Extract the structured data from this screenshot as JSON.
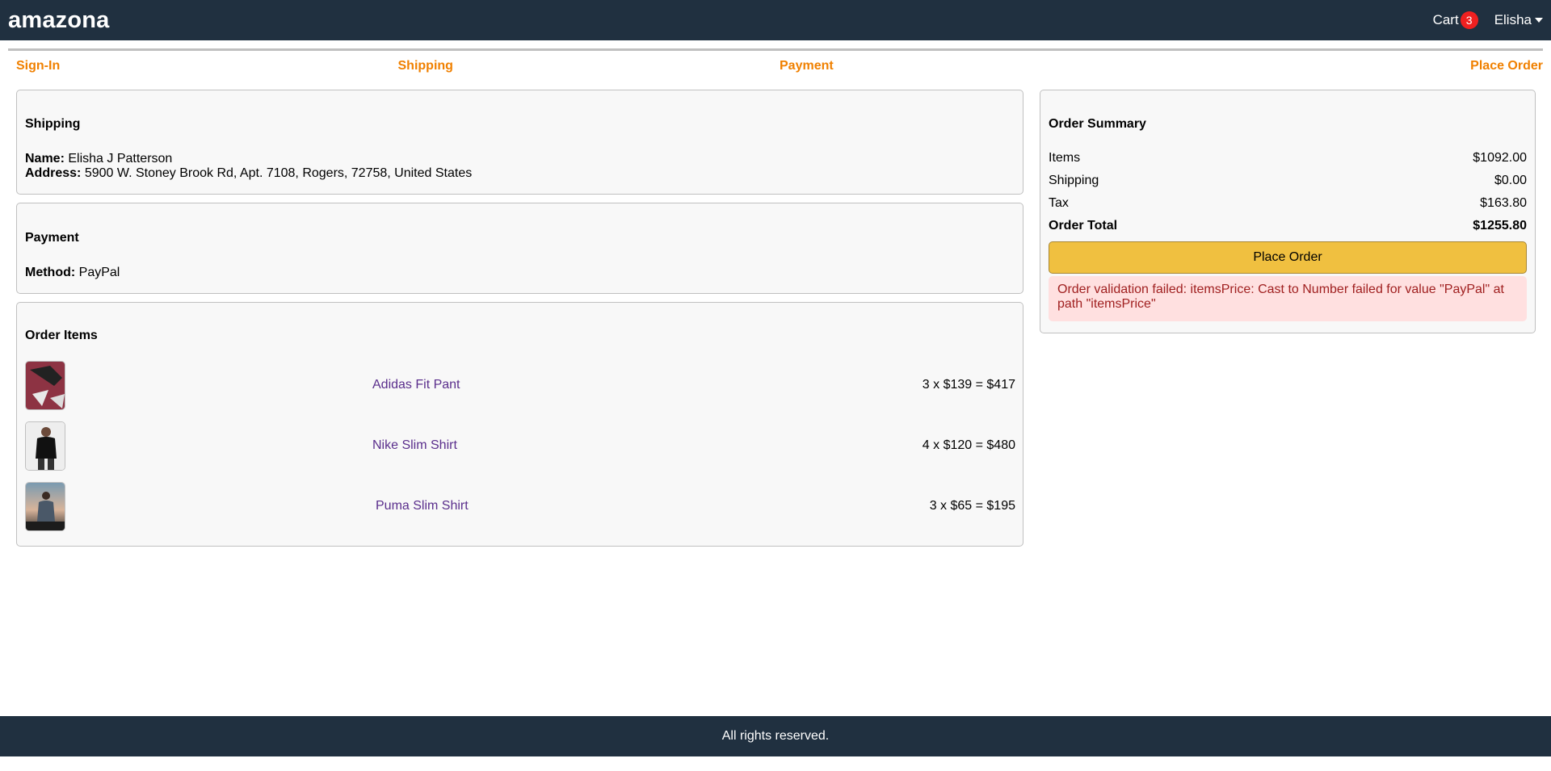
{
  "header": {
    "brand": "amazona",
    "cart_label": "Cart",
    "cart_count": "3",
    "user_name": "Elisha"
  },
  "steps": [
    "Sign-In",
    "Shipping",
    "Payment",
    "Place Order"
  ],
  "shipping": {
    "title": "Shipping",
    "name_label": "Name:",
    "name": "Elisha J Patterson",
    "address_label": "Address:",
    "address": "5900 W. Stoney Brook Rd, Apt. 7108, Rogers, 72758, United States"
  },
  "payment": {
    "title": "Payment",
    "method_label": "Method:",
    "method": "PayPal"
  },
  "order_items": {
    "title": "Order Items",
    "items": [
      {
        "name": "Adidas Fit Pant",
        "price_line": "3 x $139 = $417"
      },
      {
        "name": "Nike Slim Shirt",
        "price_line": "4 x $120 = $480"
      },
      {
        "name": "Puma Slim Shirt",
        "price_line": "3 x $65 = $195"
      }
    ]
  },
  "summary": {
    "title": "Order Summary",
    "rows": [
      {
        "label": "Items",
        "value": "$1092.00"
      },
      {
        "label": "Shipping",
        "value": "$0.00"
      },
      {
        "label": "Tax",
        "value": "$163.80"
      },
      {
        "label": "Order Total",
        "value": "$1255.80"
      }
    ],
    "place_order_label": "Place Order",
    "error_message": "Order validation failed: itemsPrice: Cast to Number failed for value \"PayPal\" at path \"itemsPrice\""
  },
  "footer": {
    "text": "All rights reserved."
  },
  "colors": {
    "header_bg": "#203040",
    "step_active": "#f08000",
    "button_bg": "#f0c040",
    "error_bg": "#ffe0e0",
    "error_text": "#a02020",
    "link_purple": "#5a2e8c",
    "badge_red": "#f02020"
  }
}
